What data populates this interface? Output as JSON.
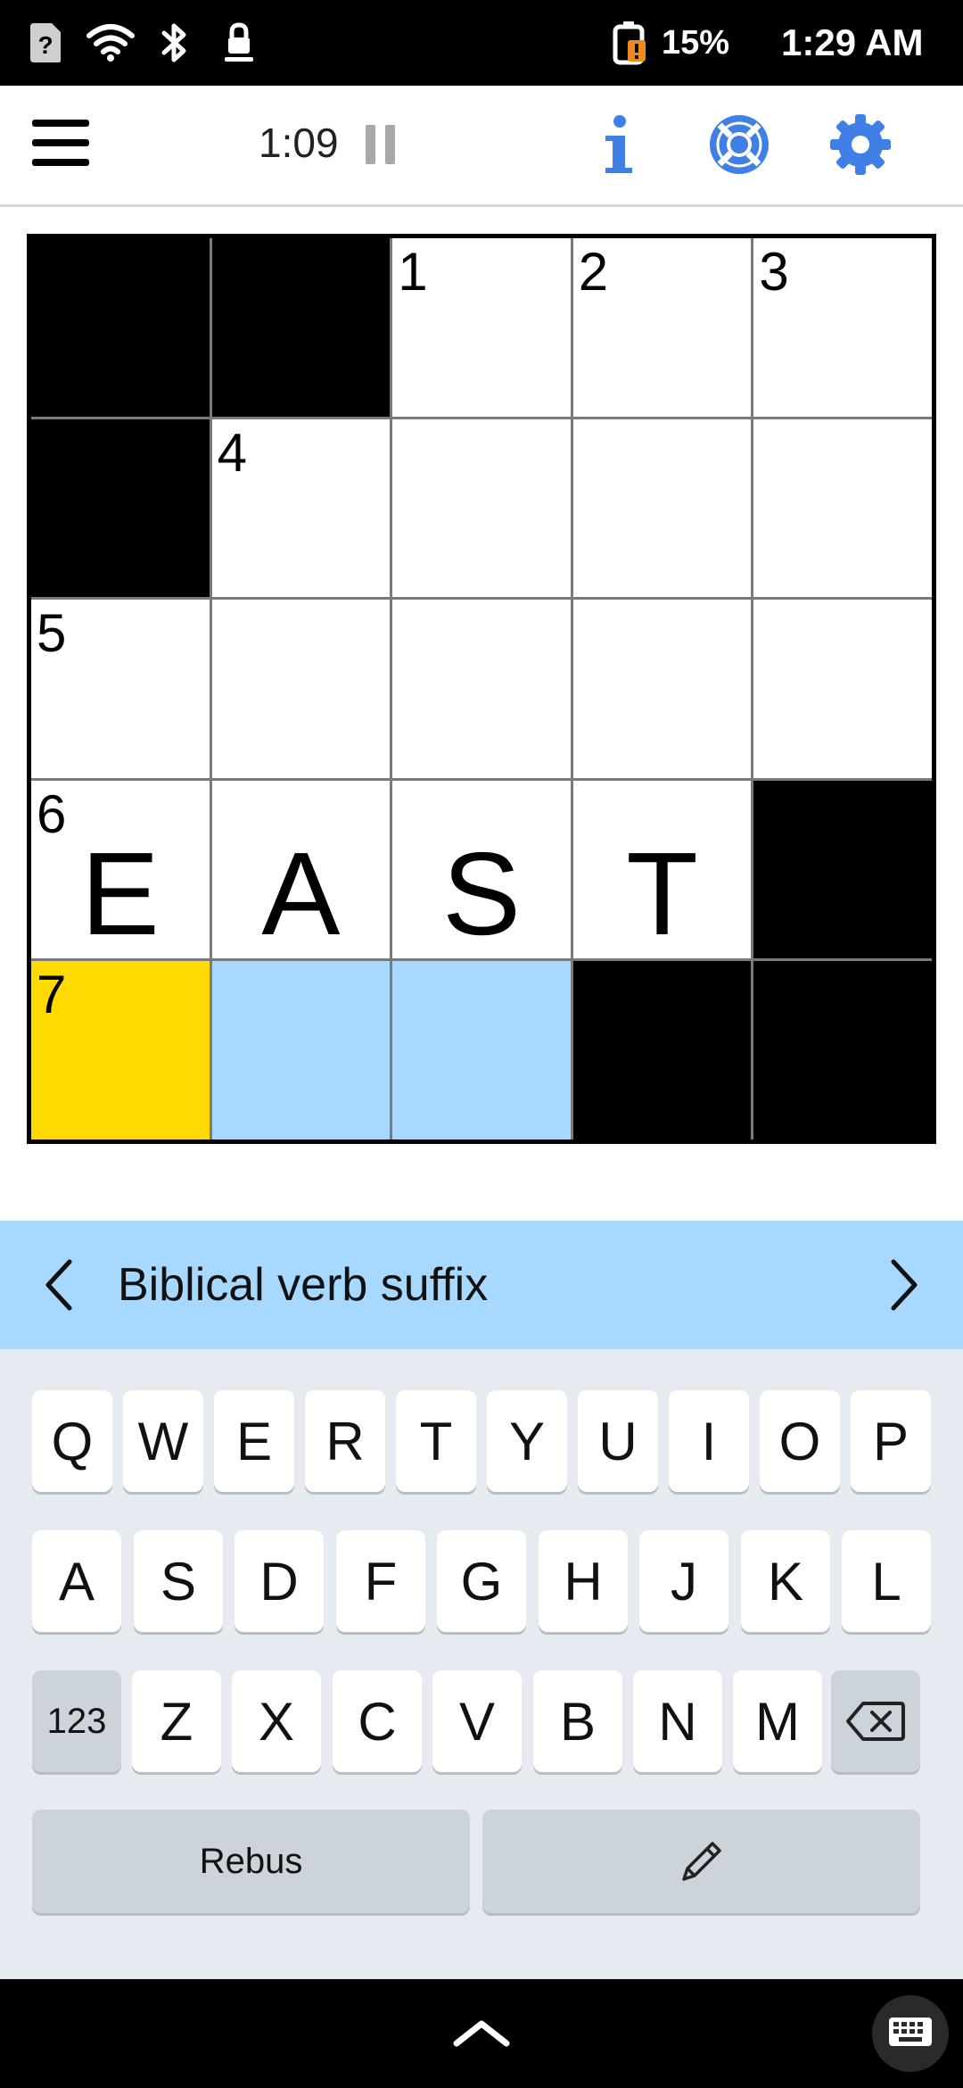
{
  "status_bar": {
    "battery_percent": "15%",
    "time": "1:29 AM",
    "icons": [
      "unknown-sim-icon",
      "wifi-icon",
      "bluetooth-icon",
      "vpn-lock-icon",
      "battery-low-icon"
    ]
  },
  "toolbar": {
    "timer": "1:09",
    "icons": [
      "menu-icon",
      "pause-icon",
      "info-icon",
      "help-lifebuoy-icon",
      "gear-icon"
    ],
    "accent_color": "#3f7fe6"
  },
  "puzzle": {
    "rows": [
      [
        {
          "black": true
        },
        {
          "black": true
        },
        {
          "num": "1",
          "letter": ""
        },
        {
          "num": "2",
          "letter": ""
        },
        {
          "num": "3",
          "letter": ""
        }
      ],
      [
        {
          "black": true
        },
        {
          "num": "4",
          "letter": ""
        },
        {
          "num": "",
          "letter": ""
        },
        {
          "num": "",
          "letter": ""
        },
        {
          "num": "",
          "letter": ""
        }
      ],
      [
        {
          "num": "5",
          "letter": ""
        },
        {
          "num": "",
          "letter": ""
        },
        {
          "num": "",
          "letter": ""
        },
        {
          "num": "",
          "letter": ""
        },
        {
          "num": "",
          "letter": ""
        }
      ],
      [
        {
          "num": "6",
          "letter": "E"
        },
        {
          "num": "",
          "letter": "A"
        },
        {
          "num": "",
          "letter": "S"
        },
        {
          "num": "",
          "letter": "T"
        },
        {
          "black": true
        }
      ],
      [
        {
          "num": "7",
          "letter": "",
          "state": "active"
        },
        {
          "num": "",
          "letter": "",
          "state": "highlight"
        },
        {
          "num": "",
          "letter": "",
          "state": "highlight"
        },
        {
          "black": true
        },
        {
          "black": true
        }
      ]
    ],
    "colors": {
      "active": "#ffda00",
      "highlight": "#a7d8ff",
      "black": "#000000"
    }
  },
  "clue": {
    "text": "Biblical verb suffix",
    "prev_icon": "chevron-left-icon",
    "next_icon": "chevron-right-icon"
  },
  "keyboard": {
    "row1": [
      "Q",
      "W",
      "E",
      "R",
      "T",
      "Y",
      "U",
      "I",
      "O",
      "P"
    ],
    "row2": [
      "A",
      "S",
      "D",
      "F",
      "G",
      "H",
      "J",
      "K",
      "L"
    ],
    "row3": [
      "Z",
      "X",
      "C",
      "V",
      "B",
      "N",
      "M"
    ],
    "numbers_key": "123",
    "backspace_icon": "backspace-icon",
    "rebus_key": "Rebus",
    "pencil_icon": "pencil-icon"
  },
  "nav_bar": {
    "icons": [
      "chevron-up-icon",
      "keyboard-icon"
    ]
  }
}
